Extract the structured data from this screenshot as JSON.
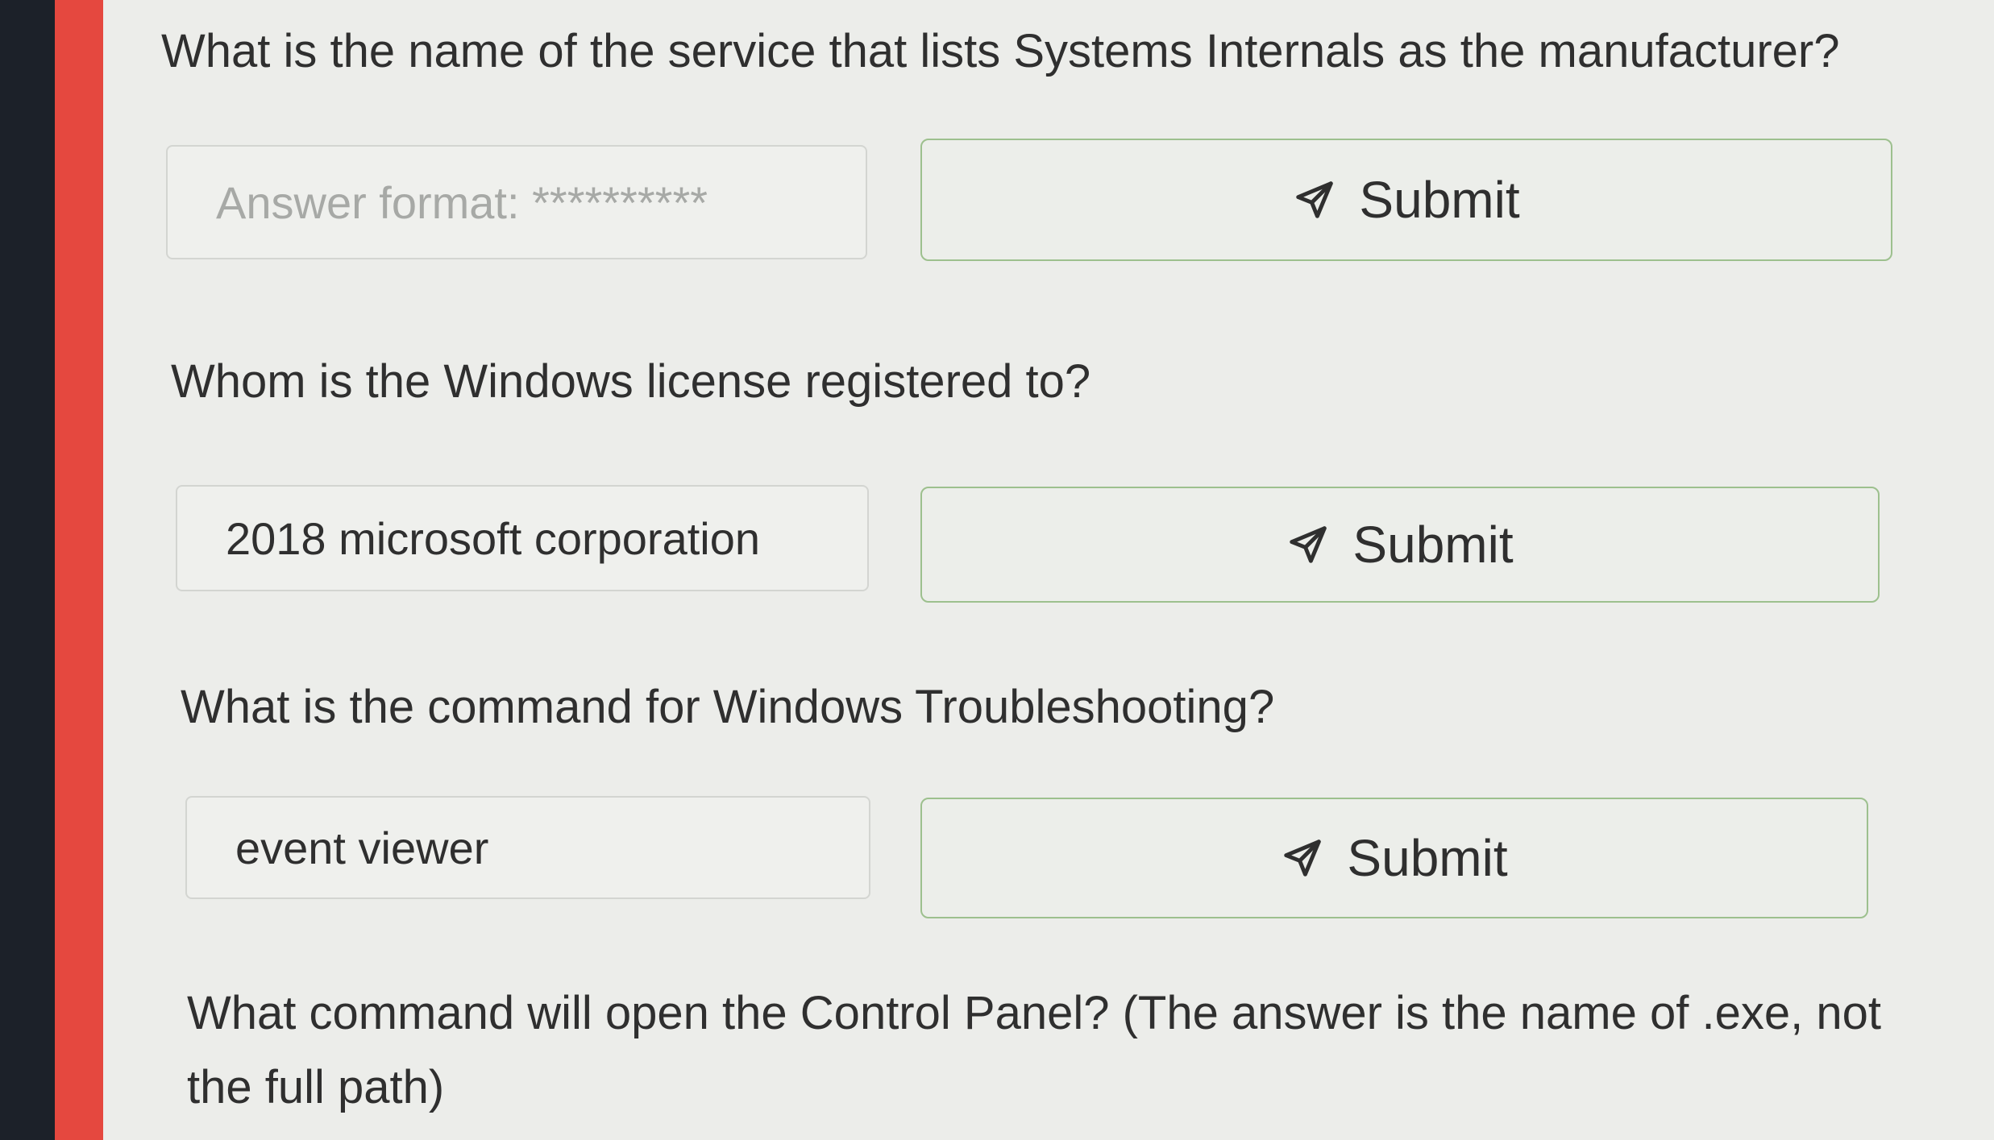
{
  "questions": [
    {
      "text": "What is the name of the service that lists Systems Internals as the manufacturer?",
      "input_value": "",
      "input_placeholder": "Answer format: **********",
      "submit_label": "Submit"
    },
    {
      "text": "Whom is the Windows license registered to?",
      "input_value": "2018 microsoft corporation",
      "input_placeholder": "",
      "submit_label": "Submit"
    },
    {
      "text": "What is the command for Windows Troubleshooting?",
      "input_value": "event viewer",
      "input_placeholder": "",
      "submit_label": "Submit"
    },
    {
      "text": "What command will open the Control Panel? (The answer is  the name of .exe, not the full path)"
    }
  ],
  "icons": {
    "submit": "paper-plane-icon"
  },
  "colors": {
    "accent_bar": "#e5483f",
    "submit_border": "#9dc08e"
  }
}
